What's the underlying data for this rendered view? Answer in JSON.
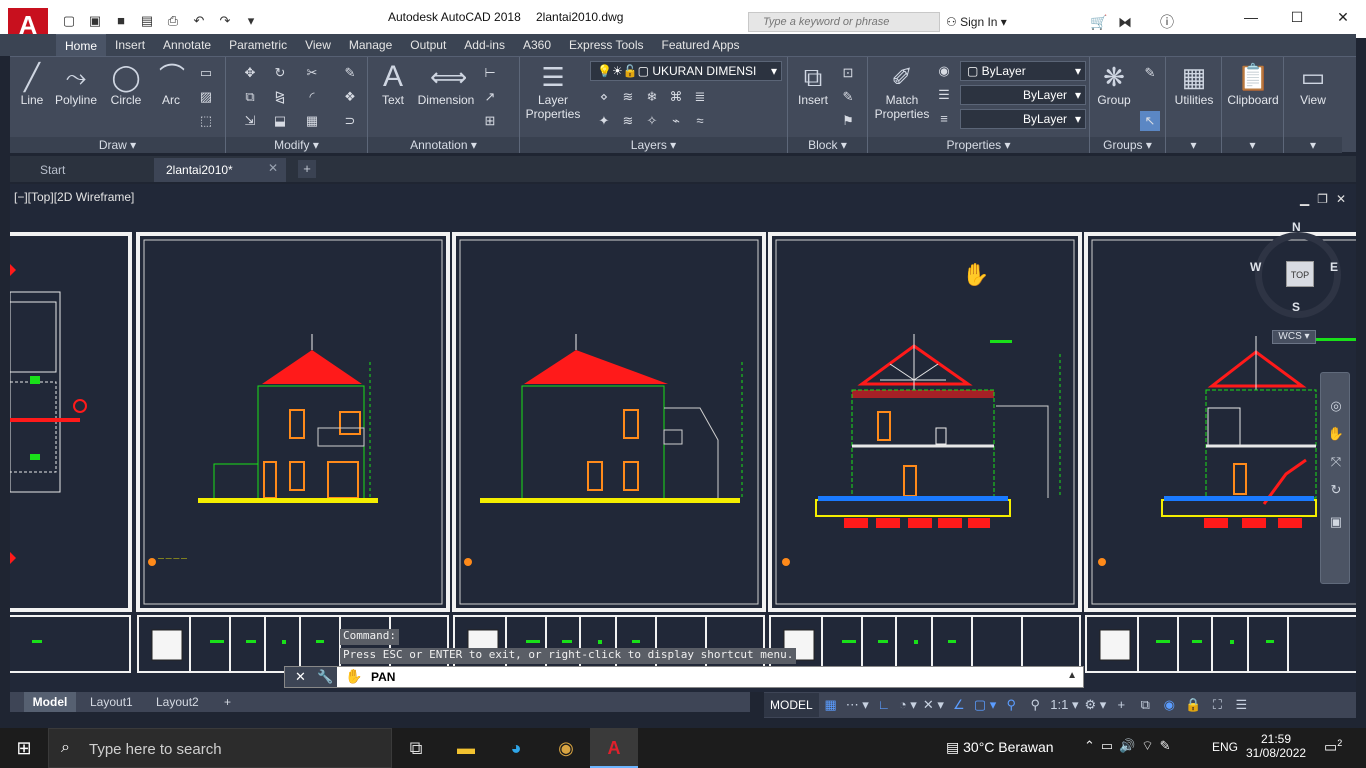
{
  "titlebar": {
    "app_title": "Autodesk AutoCAD 2018",
    "file_name": "2lantai2010.dwg",
    "search_placeholder": "Type a keyword or phrase",
    "sign_in": "Sign In"
  },
  "ribbon_tabs": [
    "Home",
    "Insert",
    "Annotate",
    "Parametric",
    "View",
    "Manage",
    "Output",
    "Add-ins",
    "A360",
    "Express Tools",
    "Featured Apps"
  ],
  "ribbon": {
    "draw": {
      "title": "Draw",
      "line": "Line",
      "polyline": "Polyline",
      "circle": "Circle",
      "arc": "Arc"
    },
    "modify": {
      "title": "Modify"
    },
    "annotation": {
      "title": "Annotation",
      "text": "Text",
      "dimension": "Dimension"
    },
    "layers": {
      "title": "Layers",
      "layer_properties_1": "Layer",
      "layer_properties_2": "Properties",
      "current_layer": "UKURAN DIMENSI"
    },
    "block": {
      "title": "Block",
      "insert": "Insert"
    },
    "properties": {
      "title": "Properties",
      "match_1": "Match",
      "match_2": "Properties",
      "color": "ByLayer",
      "linetype": "ByLayer",
      "lineweight": "ByLayer"
    },
    "groups": {
      "title": "Groups",
      "group": "Group"
    },
    "utilities": "Utilities",
    "clipboard": "Clipboard",
    "view": "View"
  },
  "doc_tabs": {
    "start": "Start",
    "active": "2lantai2010*"
  },
  "viewport": {
    "label": "[−][Top][2D Wireframe]"
  },
  "viewcube": {
    "top": "TOP",
    "n": "N",
    "s": "S",
    "e": "E",
    "w": "W",
    "wcs": "WCS"
  },
  "command": {
    "history_1": "Command:",
    "history_2": "Press ESC or ENTER to exit, or right-click to display shortcut menu.",
    "current": "PAN"
  },
  "layout_tabs": [
    "Model",
    "Layout1",
    "Layout2"
  ],
  "status": {
    "model": "MODEL",
    "scale": "1:1"
  },
  "taskbar": {
    "search": "Type here to search",
    "weather": "30°C  Berawan",
    "lang": "ENG",
    "time": "21:59",
    "date": "31/08/2022",
    "notifications": "2"
  }
}
